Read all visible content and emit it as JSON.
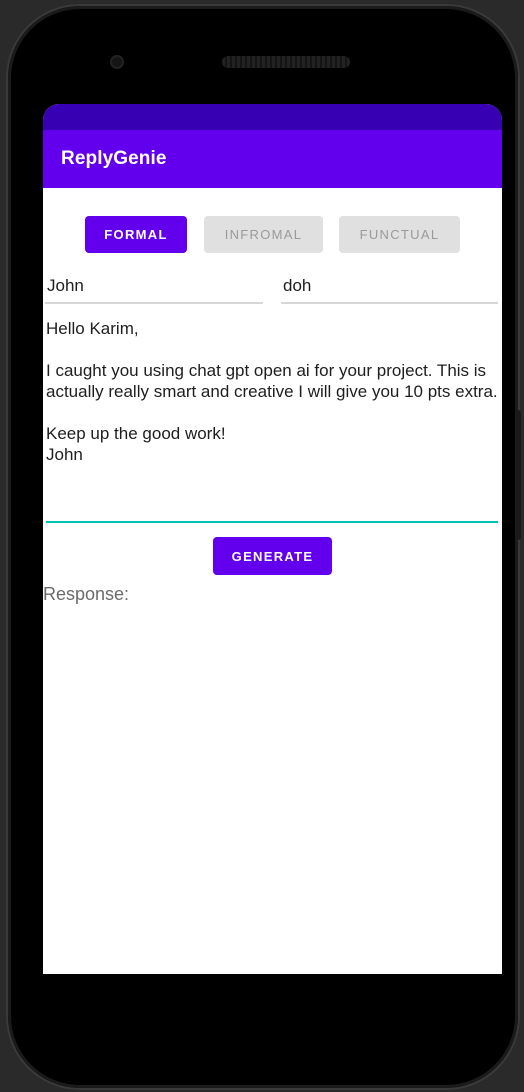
{
  "app": {
    "title": "ReplyGenie"
  },
  "tone_buttons": [
    {
      "label": "FORMAL",
      "selected": true
    },
    {
      "label": "INFROMAL",
      "selected": false
    },
    {
      "label": "FUNCTUAL",
      "selected": false
    }
  ],
  "fields": {
    "sender": {
      "value": "John"
    },
    "recipient": {
      "value": "doh"
    }
  },
  "message": {
    "line1": "Hello Karim,",
    "line2": "I caught you using chat gpt open ai for your project. This is actually really smart and creative I will give you 10 pts extra.",
    "line3": "Keep up the good work!",
    "line4": "John"
  },
  "generate_button": {
    "label": "GENERATE"
  },
  "response": {
    "label": "Response:"
  },
  "colors": {
    "primary": "#6200ee",
    "primary_dark": "#3700b3",
    "accent": "#00c2b4",
    "button_muted_bg": "#e0e0e0",
    "button_muted_text": "#9a9a9a"
  }
}
